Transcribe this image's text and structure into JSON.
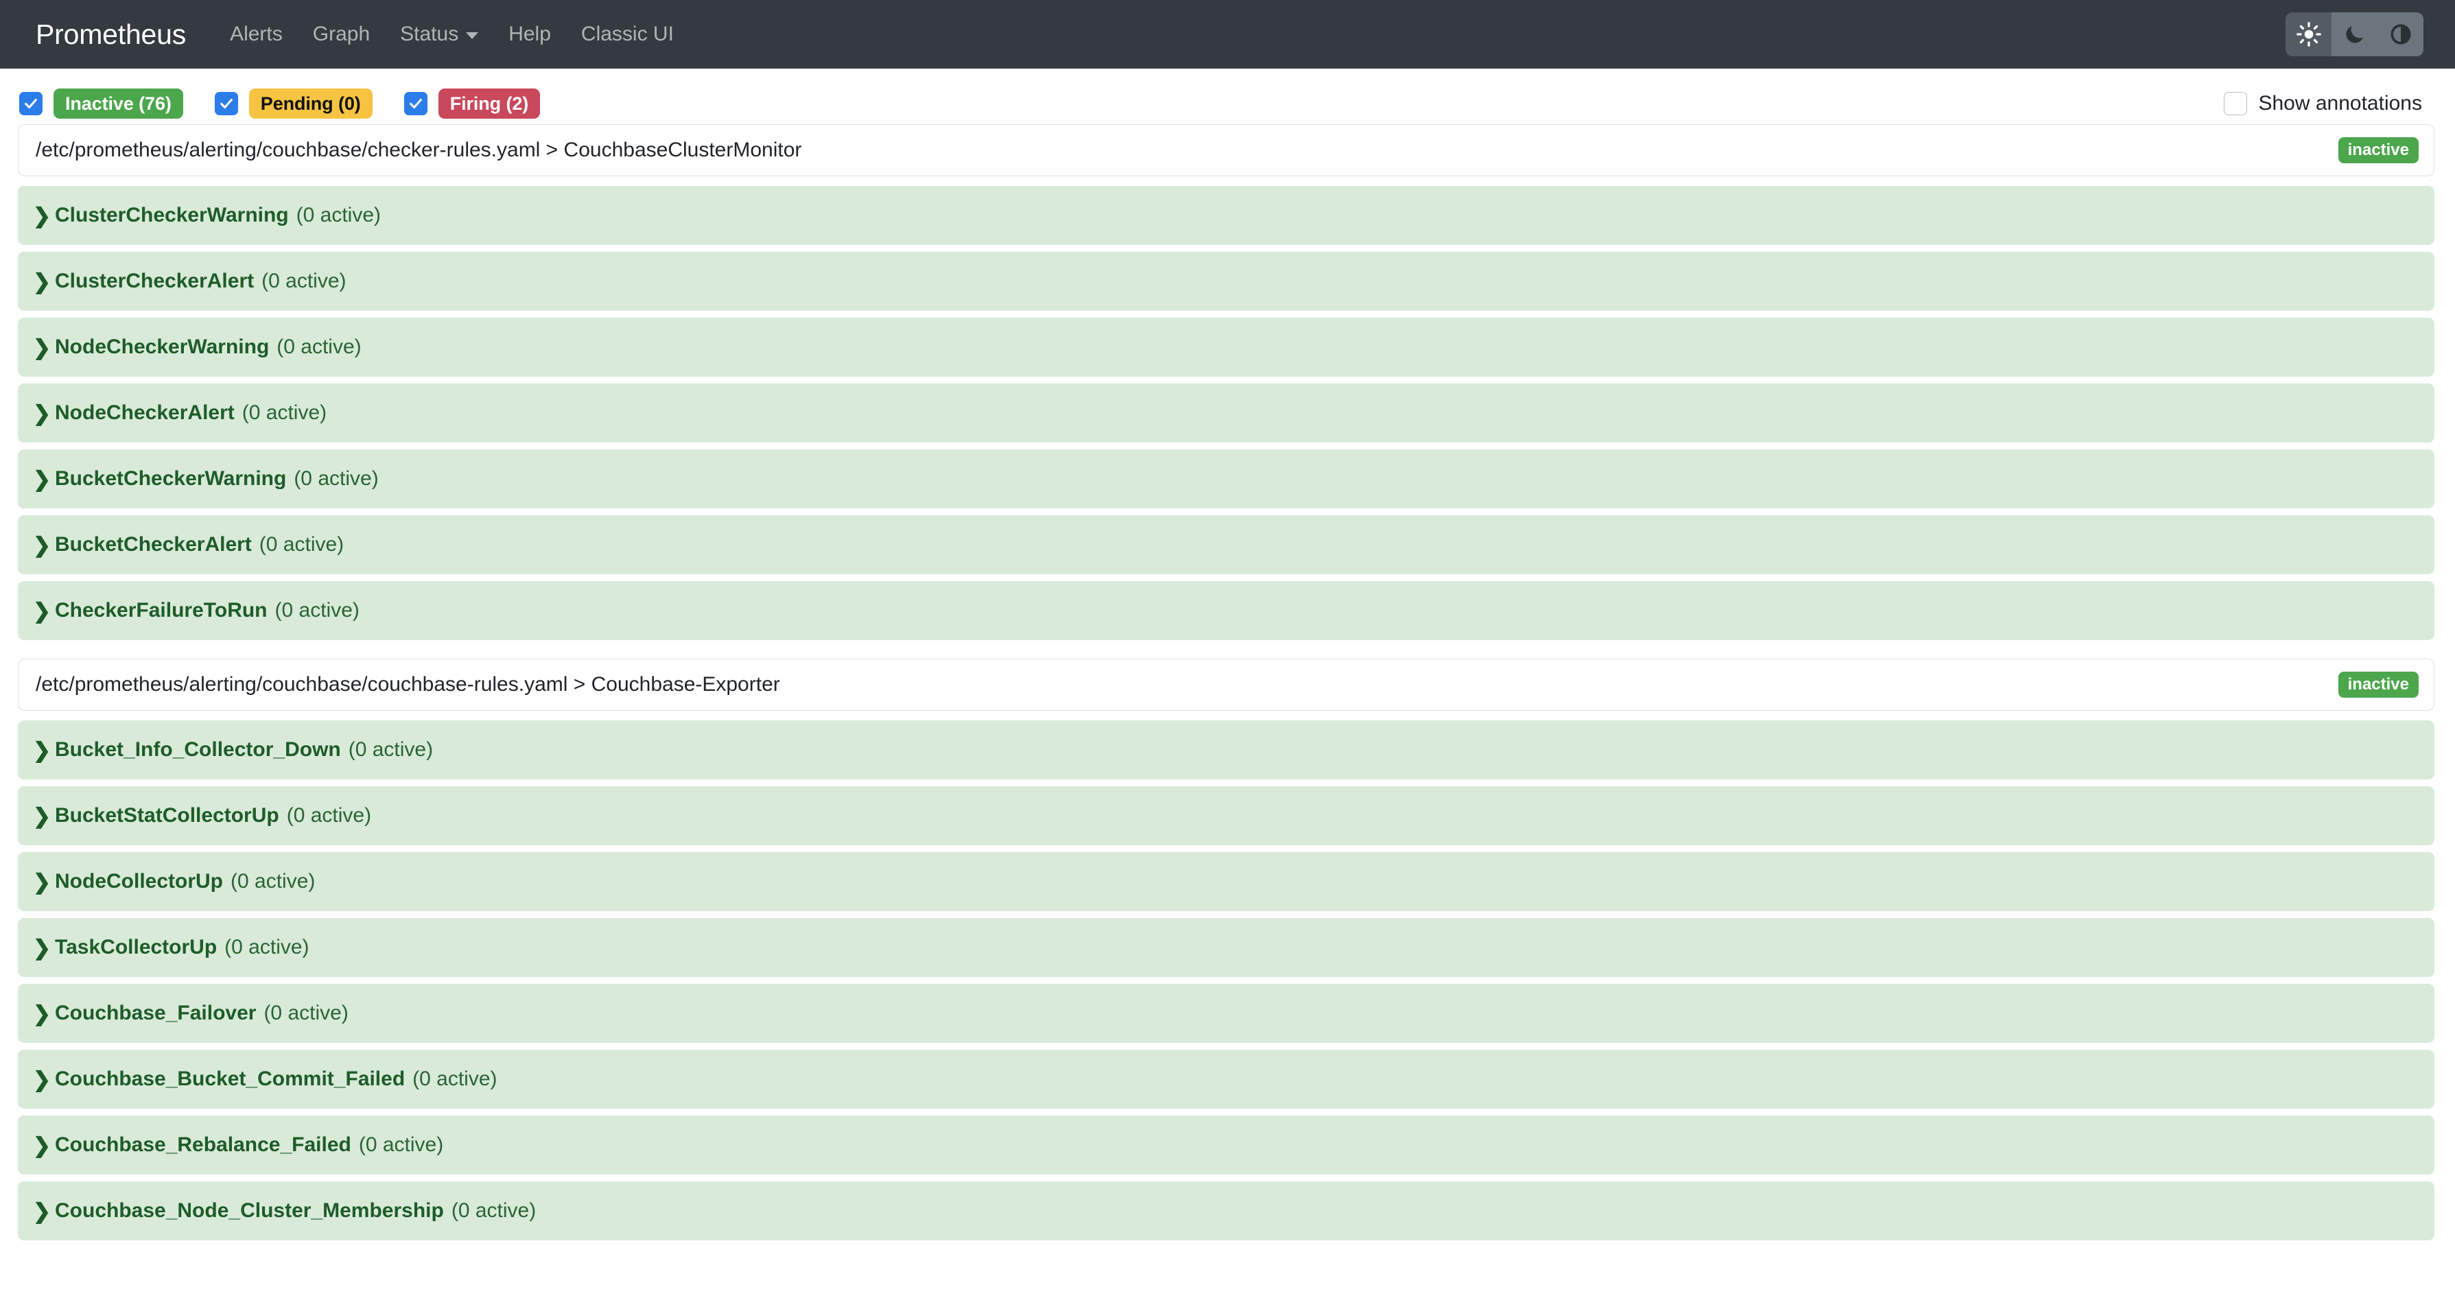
{
  "navbar": {
    "brand": "Prometheus",
    "links": [
      {
        "label": "Alerts",
        "icon": null
      },
      {
        "label": "Graph",
        "icon": null
      },
      {
        "label": "Status",
        "icon": "chevron-down-icon"
      },
      {
        "label": "Help",
        "icon": null
      },
      {
        "label": "Classic UI",
        "icon": null
      }
    ],
    "theme": {
      "light_icon": "sun-icon",
      "dark_icon": "moon-icon",
      "auto_icon": "half-circle-icon",
      "selected": "light"
    }
  },
  "filters": {
    "items": [
      {
        "label": "Inactive (76)",
        "checked": true,
        "style": "inactive"
      },
      {
        "label": "Pending (0)",
        "checked": true,
        "style": "pending"
      },
      {
        "label": "Firing (2)",
        "checked": true,
        "style": "firing"
      }
    ],
    "show_annotations": {
      "label": "Show annotations",
      "checked": false
    }
  },
  "colors": {
    "inactive": "#4ca64c",
    "pending": "#f6c343",
    "firing": "#c9485b",
    "checkbox": "#2b7de9",
    "navbar": "#343a40",
    "rule_row": "#d9ead9",
    "rule_text": "#1d5c29"
  },
  "groups": [
    {
      "path": "/etc/prometheus/alerting/couchbase/checker-rules.yaml > CouchbaseClusterMonitor",
      "state": "inactive",
      "rules": [
        {
          "name": "ClusterCheckerWarning",
          "count": "(0 active)"
        },
        {
          "name": "ClusterCheckerAlert",
          "count": "(0 active)"
        },
        {
          "name": "NodeCheckerWarning",
          "count": "(0 active)"
        },
        {
          "name": "NodeCheckerAlert",
          "count": "(0 active)"
        },
        {
          "name": "BucketCheckerWarning",
          "count": "(0 active)"
        },
        {
          "name": "BucketCheckerAlert",
          "count": "(0 active)"
        },
        {
          "name": "CheckerFailureToRun",
          "count": "(0 active)"
        }
      ]
    },
    {
      "path": "/etc/prometheus/alerting/couchbase/couchbase-rules.yaml > Couchbase-Exporter",
      "state": "inactive",
      "rules": [
        {
          "name": "Bucket_Info_Collector_Down",
          "count": "(0 active)"
        },
        {
          "name": "BucketStatCollectorUp",
          "count": "(0 active)"
        },
        {
          "name": "NodeCollectorUp",
          "count": "(0 active)"
        },
        {
          "name": "TaskCollectorUp",
          "count": "(0 active)"
        },
        {
          "name": "Couchbase_Failover",
          "count": "(0 active)"
        },
        {
          "name": "Couchbase_Bucket_Commit_Failed",
          "count": "(0 active)"
        },
        {
          "name": "Couchbase_Rebalance_Failed",
          "count": "(0 active)"
        },
        {
          "name": "Couchbase_Node_Cluster_Membership",
          "count": "(0 active)"
        }
      ]
    }
  ]
}
